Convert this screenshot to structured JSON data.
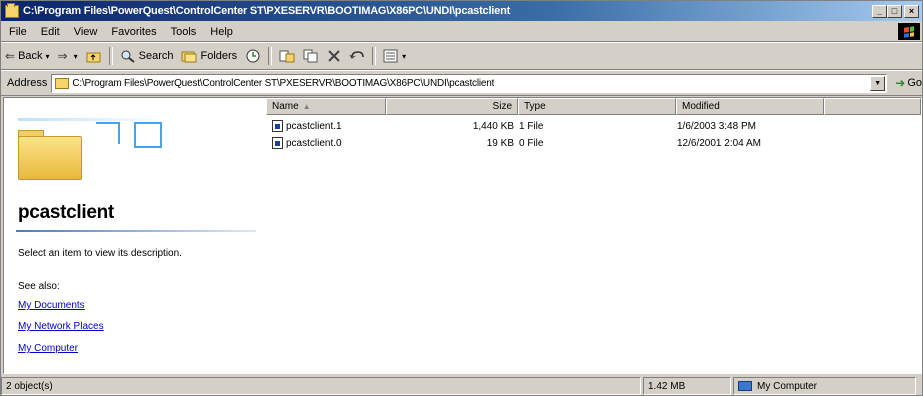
{
  "window": {
    "title": "C:\\Program Files\\PowerQuest\\ControlCenter ST\\PXESERVR\\BOOTIMAG\\X86PC\\UNDI\\pcastclient",
    "min_label": "_",
    "max_label": "□",
    "close_label": "×"
  },
  "menu": [
    "File",
    "Edit",
    "View",
    "Favorites",
    "Tools",
    "Help"
  ],
  "toolbar": {
    "back": "Back",
    "forward_glyph": "⇒",
    "search": "Search",
    "folders": "Folders",
    "back_glyph": "⇐",
    "dropdown_glyph": "▾"
  },
  "address": {
    "label": "Address",
    "value": "C:\\Program Files\\PowerQuest\\ControlCenter ST\\PXESERVR\\BOOTIMAG\\X86PC\\UNDI\\pcastclient",
    "go_label": "Go",
    "dropdown_glyph": "▼"
  },
  "left_pane": {
    "folder_name": "pcastclient",
    "description": "Select an item to view its description.",
    "see_also": "See also:",
    "links": [
      "My Documents",
      "My Network Places",
      "My Computer"
    ]
  },
  "columns": {
    "name": "Name",
    "size": "Size",
    "type": "Type",
    "modified": "Modified"
  },
  "files": [
    {
      "name": "pcastclient.1",
      "size": "1,440 KB",
      "type": "1 File",
      "modified": "1/6/2003 3:48 PM"
    },
    {
      "name": "pcastclient.0",
      "size": "19 KB",
      "type": "0 File",
      "modified": "12/6/2001 2:04 AM"
    }
  ],
  "status": {
    "objects": "2 object(s)",
    "size": "1.42 MB",
    "zone": "My Computer"
  }
}
